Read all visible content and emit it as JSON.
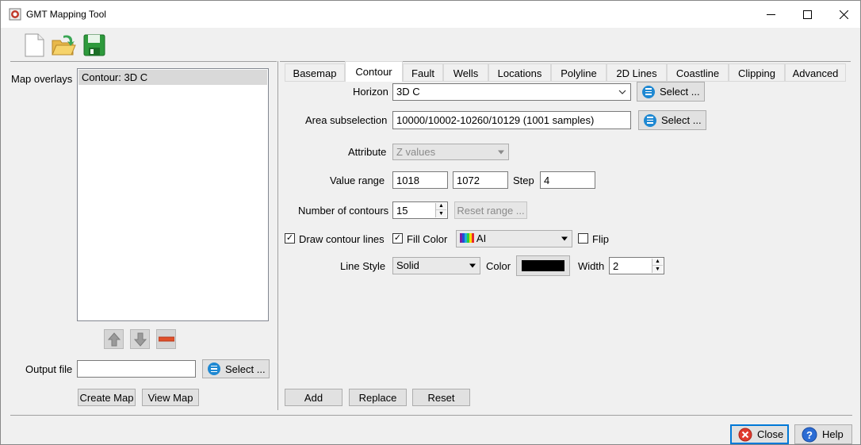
{
  "window": {
    "title": "GMT Mapping Tool"
  },
  "toolbar": {
    "icons": [
      "new-file-icon",
      "open-folder-icon",
      "save-icon"
    ]
  },
  "left": {
    "overlays_label": "Map overlays",
    "overlays": [
      "Contour: 3D C"
    ],
    "output_label": "Output file",
    "output_value": "",
    "select_label": "Select ...",
    "create_map": "Create Map",
    "view_map": "View Map"
  },
  "tabs": [
    "Basemap",
    "Contour",
    "Fault",
    "Wells",
    "Locations",
    "Polyline",
    "2D Lines",
    "Coastline",
    "Clipping",
    "Advanced"
  ],
  "contour": {
    "horizon_label": "Horizon",
    "horizon_value": "3D C",
    "select_label": "Select ...",
    "area_label": "Area subselection",
    "area_value": "10000/10002-10260/10129 (1001 samples)",
    "attribute_label": "Attribute",
    "attribute_value": "Z values",
    "value_range_label": "Value range",
    "range_min": "1018",
    "range_max": "1072",
    "step_label": "Step",
    "step_value": "4",
    "num_contours_label": "Number of contours",
    "num_contours_value": "15",
    "reset_range": "Reset range ...",
    "draw_lines_label": "Draw contour lines",
    "fill_color_label": "Fill Color",
    "colortable_value": "AI",
    "flip_label": "Flip",
    "line_style_label": "Line Style",
    "line_style_value": "Solid",
    "color_label": "Color",
    "line_color": "#000000",
    "width_label": "Width",
    "width_value": "2"
  },
  "actions": {
    "add": "Add",
    "replace": "Replace",
    "reset": "Reset"
  },
  "footer": {
    "close": "Close",
    "help": "Help"
  }
}
